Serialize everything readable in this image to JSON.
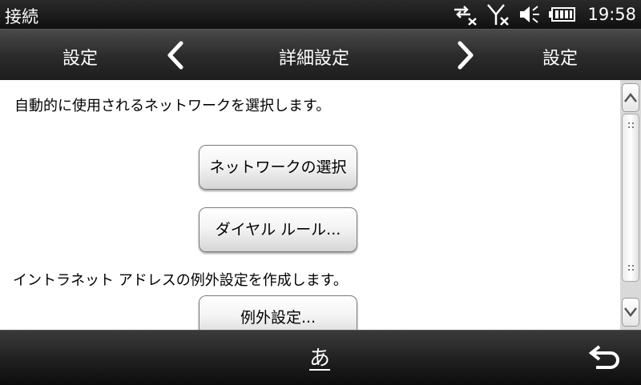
{
  "status": {
    "title": "接続",
    "time": "19:58",
    "icons": [
      "data-connection-off-icon",
      "signal-off-icon",
      "speaker-muted-icon",
      "battery-icon"
    ]
  },
  "header": {
    "left_label": "設定",
    "title": "詳細設定",
    "right_label": "設定",
    "prev_icon": "chevron-left-icon",
    "next_icon": "chevron-right-icon"
  },
  "content": {
    "network_description": "自動的に使用されるネットワークを選択します。",
    "select_network_button": "ネットワークの選択",
    "dial_rules_button": "ダイヤル ルール...",
    "intranet_description": "イントラネット アドレスの例外設定を作成します。",
    "exceptions_button": "例外設定..."
  },
  "bottom": {
    "ime_label": "あ",
    "back_icon": "back-arrow-icon"
  },
  "colors": {
    "content_background": "#ffffff",
    "bar_background": "#1c1c1c",
    "text_light": "#ffffff",
    "text_dark": "#000000"
  }
}
